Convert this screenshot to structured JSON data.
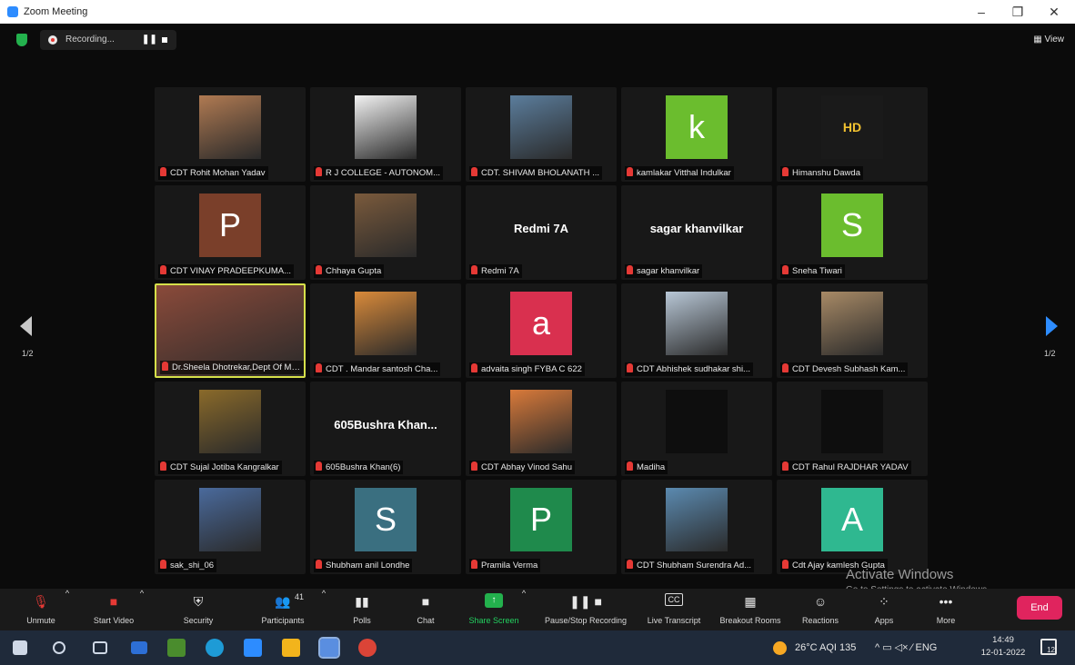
{
  "window": {
    "title": "Zoom Meeting",
    "minimize": "–",
    "maximize": "❐",
    "close": "✕"
  },
  "topbar": {
    "recording_label": "Recording...",
    "pause": "❚❚",
    "view_label": "▦ View"
  },
  "pagination": {
    "left": "1/2",
    "right": "1/2"
  },
  "participants": [
    {
      "name": "CDT Rohit Mohan Yadav",
      "kind": "photo",
      "color": "#b07a52"
    },
    {
      "name": "R J COLLEGE - AUTONOM...",
      "kind": "photo",
      "color": "#f2f2f2"
    },
    {
      "name": "CDT. SHIVAM BHOLANATH ...",
      "kind": "photo",
      "color": "#5b7d9c"
    },
    {
      "name": "kamlakar Vitthal Indulkar",
      "kind": "letter",
      "letter": "k",
      "color": "#6bbd2e"
    },
    {
      "name": "Himanshu Dawda",
      "kind": "hd",
      "letter": "HD",
      "color": "#1a1a1a"
    },
    {
      "name": "CDT VINAY PRADEEPKUMA...",
      "kind": "letter",
      "letter": "P",
      "color": "#7a3f2a"
    },
    {
      "name": "Chhaya Gupta",
      "kind": "photo",
      "color": "#7a5a3c"
    },
    {
      "name": "Redmi 7A",
      "kind": "text",
      "letter": "Redmi 7A"
    },
    {
      "name": "sagar khanvilkar",
      "kind": "text",
      "letter": "sagar khanvilkar"
    },
    {
      "name": "Sneha Tiwari",
      "kind": "letter",
      "letter": "S",
      "color": "#6bbd2e"
    },
    {
      "name": "Dr.Sheela Dhotrekar,Dept Of Ma...",
      "kind": "photo",
      "color": "#8a4a3a",
      "active": true
    },
    {
      "name": "CDT . Mandar santosh Cha...",
      "kind": "photo",
      "color": "#d98a3a"
    },
    {
      "name": "advaita singh FYBA C 622",
      "kind": "letter",
      "letter": "a",
      "color": "#d9304f"
    },
    {
      "name": "CDT Abhishek sudhakar shi...",
      "kind": "photo",
      "color": "#b8c7d6"
    },
    {
      "name": "CDT Devesh Subhash Kam...",
      "kind": "photo",
      "color": "#a88a66"
    },
    {
      "name": "CDT Sujal Jotiba Kangralkar",
      "kind": "photo",
      "color": "#8a6a2a"
    },
    {
      "name": "605Bushra Khan(6)",
      "kind": "text",
      "letter": "605Bushra Khan..."
    },
    {
      "name": "CDT Abhay Vinod Sahu",
      "kind": "photo",
      "color": "#d97a3a"
    },
    {
      "name": "Madiha",
      "kind": "dark"
    },
    {
      "name": "CDT Rahul RAJDHAR YADAV",
      "kind": "dark"
    },
    {
      "name": "sak_shi_06",
      "kind": "photo",
      "color": "#4a6a9c"
    },
    {
      "name": "Shubham anil Londhe",
      "kind": "letter",
      "letter": "S",
      "color": "#3a6f80"
    },
    {
      "name": "Pramila Verma",
      "kind": "letter",
      "letter": "P",
      "color": "#1f8a4c"
    },
    {
      "name": "CDT Shubham Surendra Ad...",
      "kind": "photo",
      "color": "#5b8ab0"
    },
    {
      "name": "Cdt Ajay kamlesh Gupta",
      "kind": "letter",
      "letter": "A",
      "color": "#2fb890"
    }
  ],
  "watermark": {
    "line1": "Activate Windows",
    "line2": "Go to Settings to activate Windows."
  },
  "toolbar": {
    "unmute": "Unmute",
    "start_video": "Start Video",
    "security": "Security",
    "participants": "Participants",
    "participants_count": "41",
    "polls": "Polls",
    "chat": "Chat",
    "share_screen": "Share Screen",
    "pause_recording": "Pause/Stop Recording",
    "live_transcript": "Live Transcript",
    "breakout_rooms": "Breakout Rooms",
    "reactions": "Reactions",
    "apps": "Apps",
    "more": "More",
    "end": "End"
  },
  "taskbar": {
    "weather": "26°C  AQI 135",
    "tray": "^  ▭  ◁×  ⁄  ENG",
    "time": "14:49",
    "date": "12-01-2022",
    "notifications": "12"
  }
}
